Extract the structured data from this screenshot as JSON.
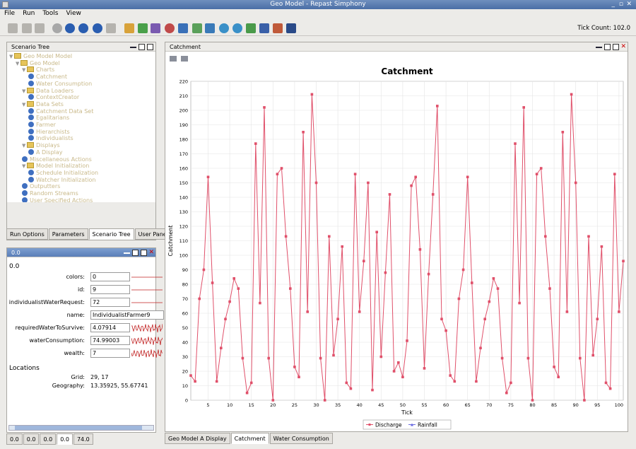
{
  "window": {
    "title": "Geo Model - Repast Simphony"
  },
  "menu": [
    {
      "label": "File"
    },
    {
      "label": "Run"
    },
    {
      "label": "Tools"
    },
    {
      "label": "View"
    }
  ],
  "toolbar": {
    "tick_count": "Tick Count: 102.0"
  },
  "scenario_tree": {
    "title": "Scenario Tree",
    "items": [
      {
        "label": "Geo Model Model",
        "level": 0,
        "kind": "model"
      },
      {
        "label": "Geo Model",
        "level": 1,
        "kind": "model"
      },
      {
        "label": "Charts",
        "level": 2,
        "kind": "folder"
      },
      {
        "label": "Catchment",
        "level": 3,
        "kind": "leaf"
      },
      {
        "label": "Water Consumption",
        "level": 3,
        "kind": "leaf"
      },
      {
        "label": "Data Loaders",
        "level": 2,
        "kind": "folder"
      },
      {
        "label": "ContextCreator",
        "level": 3,
        "kind": "leaf"
      },
      {
        "label": "Data Sets",
        "level": 2,
        "kind": "folder"
      },
      {
        "label": "Catchment Data Set",
        "level": 3,
        "kind": "leaf"
      },
      {
        "label": "Egalitarians",
        "level": 3,
        "kind": "leaf"
      },
      {
        "label": "Farmer",
        "level": 3,
        "kind": "leaf"
      },
      {
        "label": "Hierarchists",
        "level": 3,
        "kind": "leaf"
      },
      {
        "label": "Individualists",
        "level": 3,
        "kind": "leaf"
      },
      {
        "label": "Displays",
        "level": 2,
        "kind": "folder"
      },
      {
        "label": "A Display",
        "level": 3,
        "kind": "leaf"
      },
      {
        "label": "Miscellaneous Actions",
        "level": 2,
        "kind": "leaf"
      },
      {
        "label": "Model Initialization",
        "level": 2,
        "kind": "folder"
      },
      {
        "label": "Schedule Initialization",
        "level": 3,
        "kind": "leaf"
      },
      {
        "label": "Watcher Initialization",
        "level": 3,
        "kind": "leaf"
      },
      {
        "label": "Outputters",
        "level": 2,
        "kind": "leaf"
      },
      {
        "label": "Random Streams",
        "level": 2,
        "kind": "leaf"
      },
      {
        "label": "User Specified Actions",
        "level": 2,
        "kind": "leaf"
      }
    ]
  },
  "left_tabs": [
    {
      "label": "Run Options"
    },
    {
      "label": "Parameters"
    },
    {
      "label": "Scenario Tree",
      "selected": true
    },
    {
      "label": "User Panel"
    }
  ],
  "props_panel": {
    "title": "0.0",
    "section": "0.0",
    "fields": [
      {
        "label": "colors:",
        "value": "0"
      },
      {
        "label": "id:",
        "value": "9"
      },
      {
        "label": "individualistWaterRequest:",
        "value": "72"
      },
      {
        "label": "name:",
        "value": "IndividualistFarmer9"
      },
      {
        "label": "requiredWaterToSurvive:",
        "value": "4.07914"
      },
      {
        "label": "waterConsumption:",
        "value": "74.99003"
      },
      {
        "label": "wealth:",
        "value": "7"
      }
    ],
    "locations_title": "Locations",
    "grid_label": "Grid:",
    "grid_value": "29, 17",
    "geography_label": "Geography:",
    "geography_value": "13.35925, 55.67741"
  },
  "bottom_tabs": [
    {
      "label": "0.0"
    },
    {
      "label": "0.0"
    },
    {
      "label": "0.0"
    },
    {
      "label": "0.0",
      "selected": true
    },
    {
      "label": "74.0"
    }
  ],
  "chart_panel": {
    "title": "Catchment"
  },
  "chart_tabs": [
    {
      "label": "Geo Model A Display"
    },
    {
      "label": "Catchment",
      "selected": true
    },
    {
      "label": "Water Consumption"
    }
  ],
  "chart_data": {
    "type": "line",
    "title": "Catchment",
    "xlabel": "Tick",
    "ylabel": "Catchment",
    "xlim": [
      1,
      101
    ],
    "ylim": [
      0,
      220
    ],
    "xticks": [
      5,
      10,
      15,
      20,
      25,
      30,
      35,
      40,
      45,
      50,
      55,
      60,
      65,
      70,
      75,
      80,
      85,
      90,
      95,
      100
    ],
    "yticks": [
      0,
      10,
      20,
      30,
      40,
      50,
      60,
      70,
      80,
      90,
      100,
      110,
      120,
      130,
      140,
      150,
      160,
      170,
      180,
      190,
      200,
      210,
      220
    ],
    "grid": true,
    "legend_position": "bottom",
    "colors": {
      "discharge": "#e0506a",
      "rainfall": "#6a6ae0"
    },
    "series": [
      {
        "name": "Discharge",
        "x": [
          1,
          2,
          3,
          4,
          5,
          6,
          7,
          8,
          9,
          10,
          11,
          12,
          13,
          14,
          15,
          16,
          17,
          18,
          19,
          20,
          21,
          22,
          23,
          24,
          25,
          26,
          27,
          28,
          29,
          30,
          31,
          32,
          33,
          34,
          35,
          36,
          37,
          38,
          39,
          40,
          41,
          42,
          43,
          44,
          45,
          46,
          47,
          48,
          49,
          50,
          51,
          52,
          53,
          54,
          55,
          56,
          57,
          58,
          59,
          60,
          61,
          62,
          63,
          64,
          65,
          66,
          67,
          68,
          69,
          70,
          71,
          72,
          73,
          74,
          75,
          76,
          77,
          78,
          79,
          80,
          81,
          82,
          83,
          84,
          85,
          86,
          87,
          88,
          89,
          90,
          91,
          92,
          93,
          94,
          95,
          96,
          97,
          98,
          99,
          100,
          101
        ],
        "values": [
          17,
          13,
          70,
          90,
          154,
          81,
          13,
          36,
          56,
          68,
          84,
          77,
          29,
          5,
          12,
          177,
          67,
          202,
          29,
          0,
          156,
          160,
          113,
          77,
          23,
          16,
          185,
          61,
          211,
          150,
          29,
          0,
          113,
          31,
          56,
          106,
          12,
          8,
          156,
          61,
          96,
          150,
          7,
          116,
          30,
          88,
          142,
          20,
          26,
          16,
          41,
          148,
          154,
          104,
          22,
          87,
          142,
          203,
          56,
          48,
          17,
          13,
          70,
          90,
          154,
          81,
          13,
          36,
          56,
          68,
          84,
          77,
          29,
          5,
          12,
          177,
          67,
          202,
          29,
          0,
          156,
          160,
          113,
          77,
          23,
          16,
          185,
          61,
          211,
          150,
          29,
          0,
          113,
          31,
          56,
          106,
          12,
          8,
          156,
          61,
          96
        ]
      },
      {
        "name": "Rainfall",
        "values": []
      }
    ]
  }
}
